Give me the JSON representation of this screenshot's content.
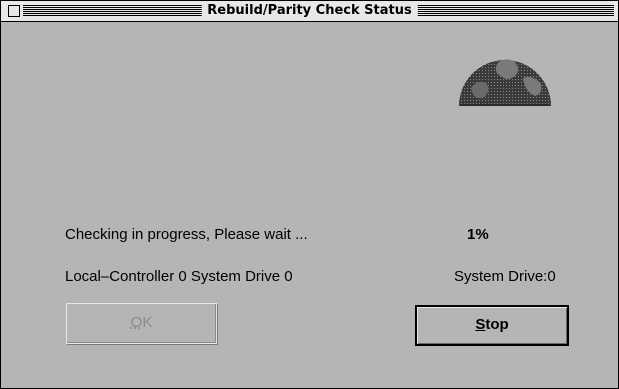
{
  "window": {
    "title": "Rebuild/Parity Check Status"
  },
  "status": {
    "message": "Checking in progress, Please wait ...",
    "percent": "1%",
    "progress_fraction": 0.01,
    "target": "Local–Controller 0 System Drive 0",
    "drive": "System Drive:0"
  },
  "buttons": {
    "ok_label": "OK",
    "ok_mnemonic": "O",
    "ok_rest": "K",
    "stop_label": "Stop",
    "stop_mnemonic": "S",
    "stop_rest": "top"
  },
  "icons": {
    "close": "close-box-icon",
    "globe": "globe-progress-icon"
  },
  "colors": {
    "window_bg": "#b5b5b5",
    "titlebar_bg": "#e8e8e8",
    "disabled_text": "#8a8a8a"
  }
}
